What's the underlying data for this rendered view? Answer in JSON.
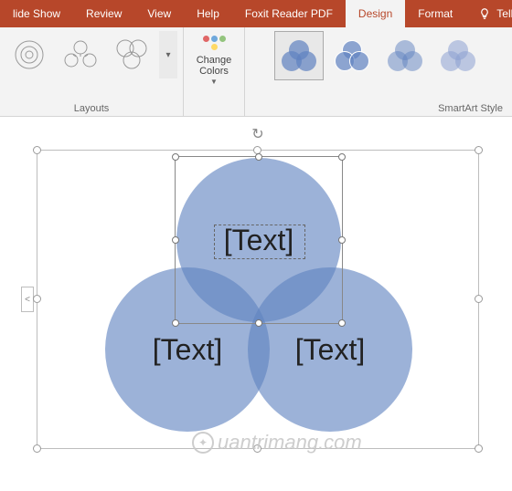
{
  "tabs": {
    "slideshow": "lide Show",
    "review": "Review",
    "view": "View",
    "help": "Help",
    "foxit": "Foxit Reader PDF",
    "design": "Design",
    "format": "Format",
    "tellme": "Tell me"
  },
  "ribbon": {
    "layouts_label": "Layouts",
    "change_colors_label": "Change\nColors",
    "styles_label": "SmartArt Style",
    "accent_dots": [
      "#e06666",
      "#6fa8dc",
      "#93c47d",
      "#ffd966"
    ]
  },
  "smartart": {
    "rotate_icon": "↻",
    "expand_icon": "<",
    "circles": {
      "top": "[Text]",
      "bottom_left": "[Text]",
      "bottom_right": "[Text]"
    }
  },
  "watermark": {
    "icon_text": "✦",
    "text": "uantrimang.com"
  },
  "colors": {
    "accent": "#b7472a",
    "venn_fill": "rgba(96,130,192,0.62)"
  }
}
